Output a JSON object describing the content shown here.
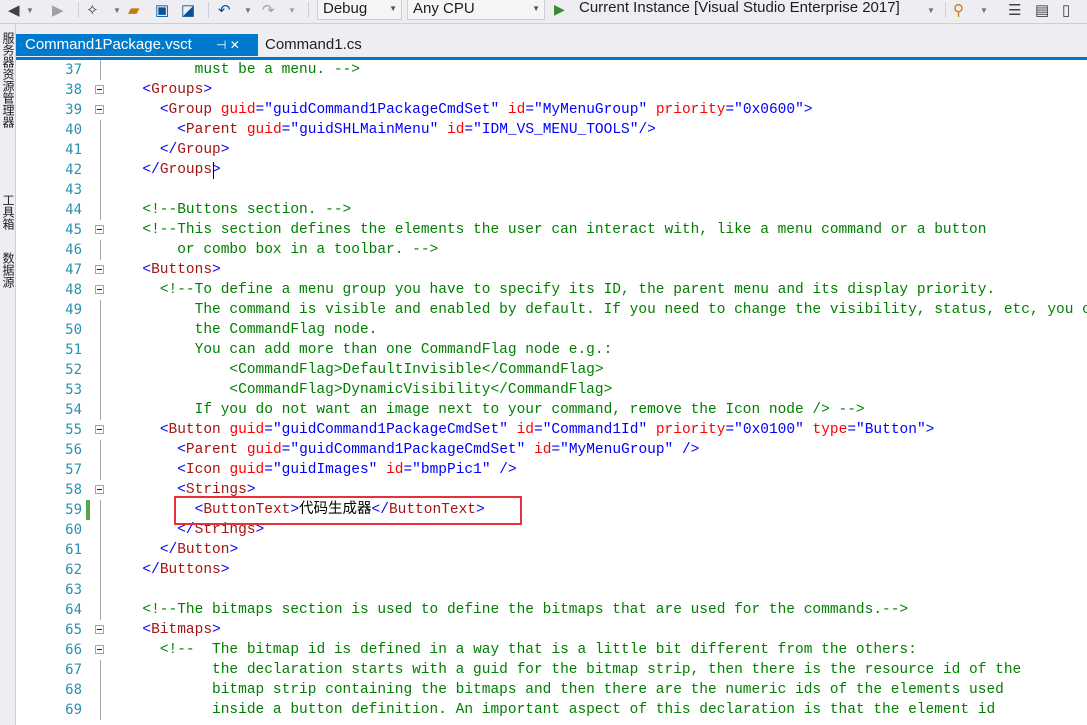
{
  "toolbar": {
    "config": "Debug",
    "platform": "Any CPU",
    "run_target": "Current Instance [Visual Studio Enterprise 2017]"
  },
  "side_tabs": [
    "服务器资源管理器",
    "工具箱",
    "数据源"
  ],
  "tabs": [
    {
      "label": "Command1Package.vsct",
      "active": true,
      "pin": "⊣ ✕"
    },
    {
      "label": "Command1.cs",
      "active": false
    }
  ],
  "accent_color": "#007acc",
  "lines": [
    {
      "n": "37",
      "fold": false,
      "changed": false,
      "tokens": [
        [
          "c",
          "        must be a menu. -->"
        ]
      ]
    },
    {
      "n": "38",
      "fold": true,
      "changed": false,
      "tokens": [
        [
          "x",
          "  "
        ],
        [
          "d",
          "<"
        ],
        [
          "t",
          "Groups"
        ],
        [
          "d",
          ">"
        ]
      ]
    },
    {
      "n": "39",
      "fold": true,
      "changed": false,
      "tokens": [
        [
          "x",
          "    "
        ],
        [
          "d",
          "<"
        ],
        [
          "t",
          "Group"
        ],
        [
          "x",
          " "
        ],
        [
          "a",
          "guid"
        ],
        [
          "d",
          "=\""
        ],
        [
          "v",
          "guidCommand1PackageCmdSet"
        ],
        [
          "d",
          "\""
        ],
        [
          "x",
          " "
        ],
        [
          "a",
          "id"
        ],
        [
          "d",
          "=\""
        ],
        [
          "v",
          "MyMenuGroup"
        ],
        [
          "d",
          "\""
        ],
        [
          "x",
          " "
        ],
        [
          "a",
          "priority"
        ],
        [
          "d",
          "=\""
        ],
        [
          "v",
          "0x0600"
        ],
        [
          "d",
          "\">"
        ]
      ]
    },
    {
      "n": "40",
      "fold": false,
      "changed": false,
      "tokens": [
        [
          "x",
          "      "
        ],
        [
          "d",
          "<"
        ],
        [
          "t",
          "Parent"
        ],
        [
          "x",
          " "
        ],
        [
          "a",
          "guid"
        ],
        [
          "d",
          "=\""
        ],
        [
          "v",
          "guidSHLMainMenu"
        ],
        [
          "d",
          "\""
        ],
        [
          "x",
          " "
        ],
        [
          "a",
          "id"
        ],
        [
          "d",
          "=\""
        ],
        [
          "v",
          "IDM_VS_MENU_TOOLS"
        ],
        [
          "d",
          "\"/>"
        ]
      ]
    },
    {
      "n": "41",
      "fold": false,
      "changed": false,
      "tokens": [
        [
          "x",
          "    "
        ],
        [
          "d",
          "</"
        ],
        [
          "t",
          "Group"
        ],
        [
          "d",
          ">"
        ]
      ]
    },
    {
      "n": "42",
      "fold": false,
      "changed": false,
      "tokens": [
        [
          "x",
          "  "
        ],
        [
          "d",
          "</"
        ],
        [
          "t",
          "Groups"
        ],
        [
          "d",
          ">"
        ]
      ]
    },
    {
      "n": "43",
      "fold": false,
      "changed": false,
      "tokens": []
    },
    {
      "n": "44",
      "fold": false,
      "changed": false,
      "tokens": [
        [
          "x",
          "  "
        ],
        [
          "c",
          "<!--Buttons section. -->"
        ]
      ]
    },
    {
      "n": "45",
      "fold": true,
      "changed": false,
      "tokens": [
        [
          "x",
          "  "
        ],
        [
          "c",
          "<!--This section defines the elements the user can interact with, like a menu command or a button"
        ]
      ]
    },
    {
      "n": "46",
      "fold": false,
      "changed": false,
      "tokens": [
        [
          "c",
          "      or combo box in a toolbar. -->"
        ]
      ]
    },
    {
      "n": "47",
      "fold": true,
      "changed": false,
      "tokens": [
        [
          "x",
          "  "
        ],
        [
          "d",
          "<"
        ],
        [
          "t",
          "Buttons"
        ],
        [
          "d",
          ">"
        ]
      ]
    },
    {
      "n": "48",
      "fold": true,
      "changed": false,
      "tokens": [
        [
          "x",
          "    "
        ],
        [
          "c",
          "<!--To define a menu group you have to specify its ID, the parent menu and its display priority."
        ]
      ]
    },
    {
      "n": "49",
      "fold": false,
      "changed": false,
      "tokens": [
        [
          "c",
          "        The command is visible and enabled by default. If you need to change the visibility, status, etc, you can use"
        ]
      ]
    },
    {
      "n": "50",
      "fold": false,
      "changed": false,
      "tokens": [
        [
          "c",
          "        the CommandFlag node."
        ]
      ]
    },
    {
      "n": "51",
      "fold": false,
      "changed": false,
      "tokens": [
        [
          "c",
          "        You can add more than one CommandFlag node e.g.:"
        ]
      ]
    },
    {
      "n": "52",
      "fold": false,
      "changed": false,
      "tokens": [
        [
          "c",
          "            <CommandFlag>DefaultInvisible</CommandFlag>"
        ]
      ]
    },
    {
      "n": "53",
      "fold": false,
      "changed": false,
      "tokens": [
        [
          "c",
          "            <CommandFlag>DynamicVisibility</CommandFlag>"
        ]
      ]
    },
    {
      "n": "54",
      "fold": false,
      "changed": false,
      "tokens": [
        [
          "c",
          "        If you do not want an image next to your command, remove the Icon node /> -->"
        ]
      ]
    },
    {
      "n": "55",
      "fold": true,
      "changed": false,
      "tokens": [
        [
          "x",
          "    "
        ],
        [
          "d",
          "<"
        ],
        [
          "t",
          "Button"
        ],
        [
          "x",
          " "
        ],
        [
          "a",
          "guid"
        ],
        [
          "d",
          "=\""
        ],
        [
          "v",
          "guidCommand1PackageCmdSet"
        ],
        [
          "d",
          "\""
        ],
        [
          "x",
          " "
        ],
        [
          "a",
          "id"
        ],
        [
          "d",
          "=\""
        ],
        [
          "v",
          "Command1Id"
        ],
        [
          "d",
          "\""
        ],
        [
          "x",
          " "
        ],
        [
          "a",
          "priority"
        ],
        [
          "d",
          "=\""
        ],
        [
          "v",
          "0x0100"
        ],
        [
          "d",
          "\""
        ],
        [
          "x",
          " "
        ],
        [
          "a",
          "type"
        ],
        [
          "d",
          "=\""
        ],
        [
          "v",
          "Button"
        ],
        [
          "d",
          "\">"
        ]
      ]
    },
    {
      "n": "56",
      "fold": false,
      "changed": false,
      "tokens": [
        [
          "x",
          "      "
        ],
        [
          "d",
          "<"
        ],
        [
          "t",
          "Parent"
        ],
        [
          "x",
          " "
        ],
        [
          "a",
          "guid"
        ],
        [
          "d",
          "=\""
        ],
        [
          "v",
          "guidCommand1PackageCmdSet"
        ],
        [
          "d",
          "\""
        ],
        [
          "x",
          " "
        ],
        [
          "a",
          "id"
        ],
        [
          "d",
          "=\""
        ],
        [
          "v",
          "MyMenuGroup"
        ],
        [
          "d",
          "\" />"
        ]
      ]
    },
    {
      "n": "57",
      "fold": false,
      "changed": false,
      "tokens": [
        [
          "x",
          "      "
        ],
        [
          "d",
          "<"
        ],
        [
          "t",
          "Icon"
        ],
        [
          "x",
          " "
        ],
        [
          "a",
          "guid"
        ],
        [
          "d",
          "=\""
        ],
        [
          "v",
          "guidImages"
        ],
        [
          "d",
          "\""
        ],
        [
          "x",
          " "
        ],
        [
          "a",
          "id"
        ],
        [
          "d",
          "=\""
        ],
        [
          "v",
          "bmpPic1"
        ],
        [
          "d",
          "\" />"
        ]
      ]
    },
    {
      "n": "58",
      "fold": true,
      "changed": false,
      "tokens": [
        [
          "x",
          "      "
        ],
        [
          "d",
          "<"
        ],
        [
          "t",
          "Strings"
        ],
        [
          "d",
          ">"
        ]
      ]
    },
    {
      "n": "59",
      "fold": false,
      "changed": true,
      "tokens": [
        [
          "x",
          "        "
        ],
        [
          "d",
          "<"
        ],
        [
          "t",
          "ButtonText"
        ],
        [
          "d",
          ">"
        ],
        [
          "x",
          "代码生成器"
        ],
        [
          "d",
          "</"
        ],
        [
          "t",
          "ButtonText"
        ],
        [
          "d",
          ">"
        ]
      ]
    },
    {
      "n": "60",
      "fold": false,
      "changed": false,
      "tokens": [
        [
          "x",
          "      "
        ],
        [
          "d",
          "</"
        ],
        [
          "t",
          "Strings"
        ],
        [
          "d",
          ">"
        ]
      ]
    },
    {
      "n": "61",
      "fold": false,
      "changed": false,
      "tokens": [
        [
          "x",
          "    "
        ],
        [
          "d",
          "</"
        ],
        [
          "t",
          "Button"
        ],
        [
          "d",
          ">"
        ]
      ]
    },
    {
      "n": "62",
      "fold": false,
      "changed": false,
      "tokens": [
        [
          "x",
          "  "
        ],
        [
          "d",
          "</"
        ],
        [
          "t",
          "Buttons"
        ],
        [
          "d",
          ">"
        ]
      ]
    },
    {
      "n": "63",
      "fold": false,
      "changed": false,
      "tokens": []
    },
    {
      "n": "64",
      "fold": false,
      "changed": false,
      "tokens": [
        [
          "x",
          "  "
        ],
        [
          "c",
          "<!--The bitmaps section is used to define the bitmaps that are used for the commands.-->"
        ]
      ]
    },
    {
      "n": "65",
      "fold": true,
      "changed": false,
      "tokens": [
        [
          "x",
          "  "
        ],
        [
          "d",
          "<"
        ],
        [
          "t",
          "Bitmaps"
        ],
        [
          "d",
          ">"
        ]
      ]
    },
    {
      "n": "66",
      "fold": true,
      "changed": false,
      "tokens": [
        [
          "x",
          "    "
        ],
        [
          "c",
          "<!--  The bitmap id is defined in a way that is a little bit different from the others:"
        ]
      ]
    },
    {
      "n": "67",
      "fold": false,
      "changed": false,
      "tokens": [
        [
          "c",
          "          the declaration starts with a guid for the bitmap strip, then there is the resource id of the"
        ]
      ]
    },
    {
      "n": "68",
      "fold": false,
      "changed": false,
      "tokens": [
        [
          "c",
          "          bitmap strip containing the bitmaps and then there are the numeric ids of the elements used"
        ]
      ]
    },
    {
      "n": "69",
      "fold": false,
      "changed": false,
      "tokens": [
        [
          "c",
          "          inside a button definition. An important aspect of this declaration is that the element id"
        ]
      ]
    }
  ]
}
